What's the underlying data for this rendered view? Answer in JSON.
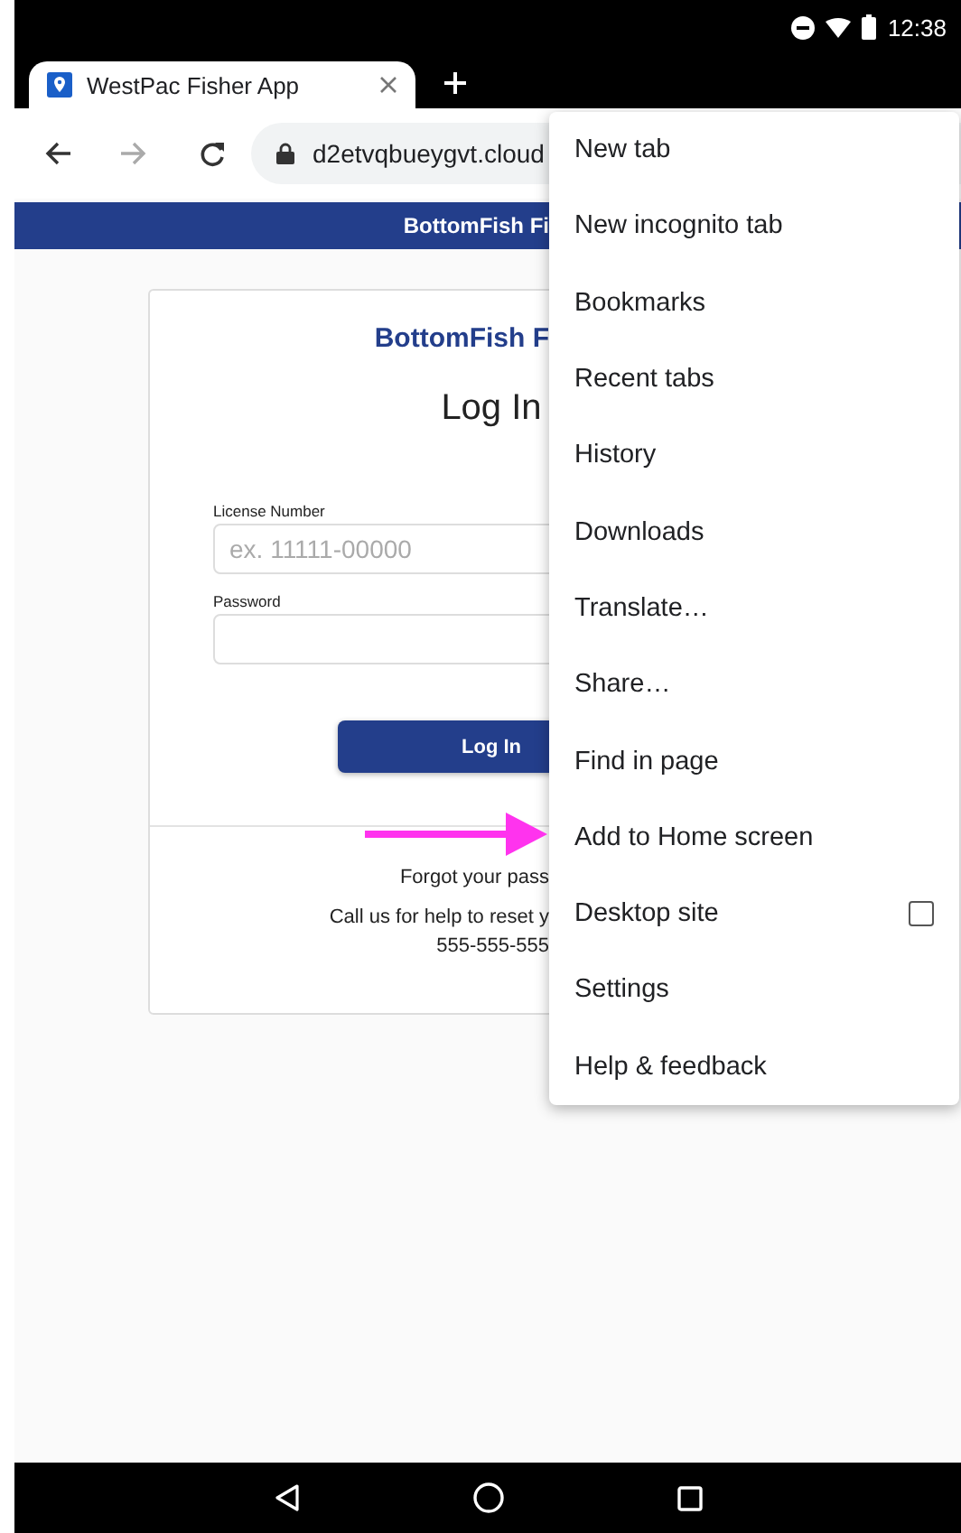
{
  "status_bar": {
    "time": "12:38"
  },
  "tab": {
    "title": "WestPac Fisher App"
  },
  "toolbar": {
    "url": "d2etvqbueygvt.cloud"
  },
  "page": {
    "banner": "BottomFish Fi",
    "card": {
      "brand": "BottomFish F",
      "title": "Log In",
      "fields": [
        {
          "label": "License Number",
          "placeholder": "ex. 11111-00000"
        },
        {
          "label": "Password"
        }
      ],
      "button": "Log In",
      "forgot": "Forgot your pass",
      "help": "Call us for help to reset y",
      "phone": "555-555-555"
    }
  },
  "menu": {
    "items": [
      {
        "label": "New tab",
        "kind": "item"
      },
      {
        "label": "New incognito tab",
        "kind": "item"
      },
      {
        "label": "Bookmarks",
        "kind": "item"
      },
      {
        "label": "Recent tabs",
        "kind": "item"
      },
      {
        "label": "History",
        "kind": "item"
      },
      {
        "label": "Downloads",
        "kind": "item"
      },
      {
        "label": "Translate…",
        "kind": "item"
      },
      {
        "label": "Share…",
        "kind": "item"
      },
      {
        "label": "Find in page",
        "kind": "item"
      },
      {
        "label": "Add to Home screen",
        "kind": "item"
      },
      {
        "label": "Desktop site",
        "kind": "checkbox",
        "checked": false
      },
      {
        "label": "Settings",
        "kind": "item"
      },
      {
        "label": "Help & feedback",
        "kind": "item"
      }
    ]
  }
}
